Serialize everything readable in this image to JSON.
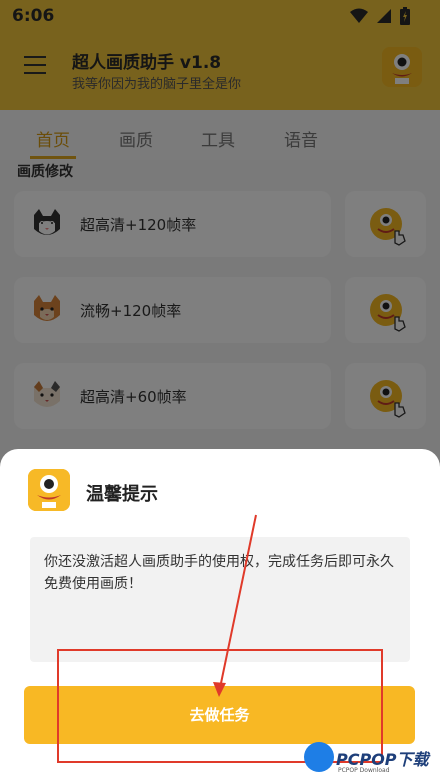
{
  "status_bar": {
    "time": "6:06",
    "icons": [
      "wifi-icon",
      "signal-icon",
      "battery-icon"
    ]
  },
  "header": {
    "title": "超人画质助手 v1.8",
    "subtitle": "我等你因为我的脑子里全是你"
  },
  "tabs": [
    {
      "label": "首页",
      "active": true
    },
    {
      "label": "画质",
      "active": false
    },
    {
      "label": "工具",
      "active": false
    },
    {
      "label": "语音",
      "active": false
    }
  ],
  "section_title": "画质修改",
  "cards": [
    {
      "label": "超高清+120帧率",
      "icon": "cat-icon-black-white"
    },
    {
      "label": "流畅+120帧率",
      "icon": "cat-icon-orange"
    },
    {
      "label": "超高清+60帧率",
      "icon": "cat-icon-calico"
    }
  ],
  "dialog": {
    "title": "温馨提示",
    "message": "你还没激活超人画质助手的使用权，完成任务后即可永久免费使用画质！",
    "button_label": "去做任务"
  },
  "watermark": {
    "text": "PCPOP下载",
    "small": "PCPOP Download"
  },
  "colors": {
    "accent": "#f0c43a",
    "button": "#f8b824",
    "annotation": "#e03a2a"
  }
}
